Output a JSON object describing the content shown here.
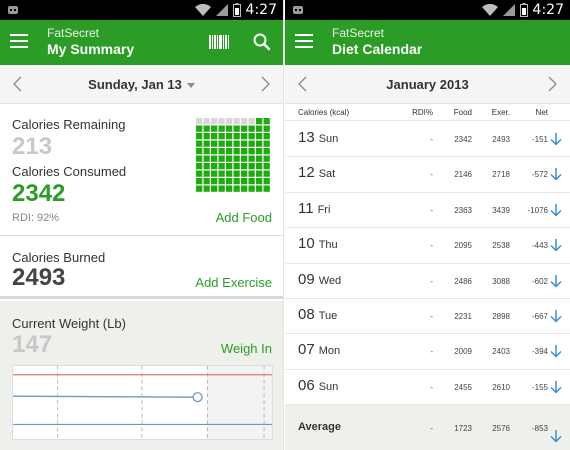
{
  "left": {
    "status_time": "4:27",
    "app_name": "FatSecret",
    "screen_title": "My Summary",
    "date": "Sunday, Jan 13",
    "calories_remaining_label": "Calories Remaining",
    "calories_remaining": "213",
    "calories_consumed_label": "Calories Consumed",
    "calories_consumed": "2342",
    "rdi": "RDI: 92%",
    "add_food": "Add Food",
    "calories_burned_label": "Calories Burned",
    "calories_burned": "2493",
    "add_exercise": "Add Exercise",
    "weight_label": "Current Weight (Lb)",
    "weight_value": "147",
    "weigh_in": "Weigh In",
    "progress_grid": {
      "total": 100,
      "filled": 92,
      "filled_color": "#1faa10",
      "empty_color": "#d8d8d8"
    }
  },
  "right": {
    "status_time": "4:27",
    "app_name": "FatSecret",
    "screen_title": "Diet Calendar",
    "month": "January 2013",
    "headers": {
      "calories": "Calories (kcal)",
      "rdi": "RDI%",
      "food": "Food",
      "exer": "Exer.",
      "net": "Net"
    },
    "rows": [
      {
        "day": "13",
        "dow": "Sun",
        "rdi": "-",
        "food": "2342",
        "exer": "2493",
        "net": "-151"
      },
      {
        "day": "12",
        "dow": "Sat",
        "rdi": "-",
        "food": "2146",
        "exer": "2718",
        "net": "-572"
      },
      {
        "day": "11",
        "dow": "Fri",
        "rdi": "-",
        "food": "2363",
        "exer": "3439",
        "net": "-1076"
      },
      {
        "day": "10",
        "dow": "Thu",
        "rdi": "-",
        "food": "2095",
        "exer": "2538",
        "net": "-443"
      },
      {
        "day": "09",
        "dow": "Wed",
        "rdi": "-",
        "food": "2486",
        "exer": "3088",
        "net": "-602"
      },
      {
        "day": "08",
        "dow": "Tue",
        "rdi": "-",
        "food": "2231",
        "exer": "2898",
        "net": "-667"
      },
      {
        "day": "07",
        "dow": "Mon",
        "rdi": "-",
        "food": "2009",
        "exer": "2403",
        "net": "-394"
      },
      {
        "day": "06",
        "dow": "Sun",
        "rdi": "-",
        "food": "2455",
        "exer": "2610",
        "net": "-155"
      }
    ],
    "average": {
      "label": "Average",
      "rdi": "-",
      "food": "1723",
      "exer": "2576",
      "net": "-853"
    }
  },
  "colors": {
    "brand_green": "#2b9c26",
    "accent_blue": "#3b8fd6",
    "weight_line_red": "#e57a6a",
    "weight_line_blue": "#6f95c9"
  }
}
